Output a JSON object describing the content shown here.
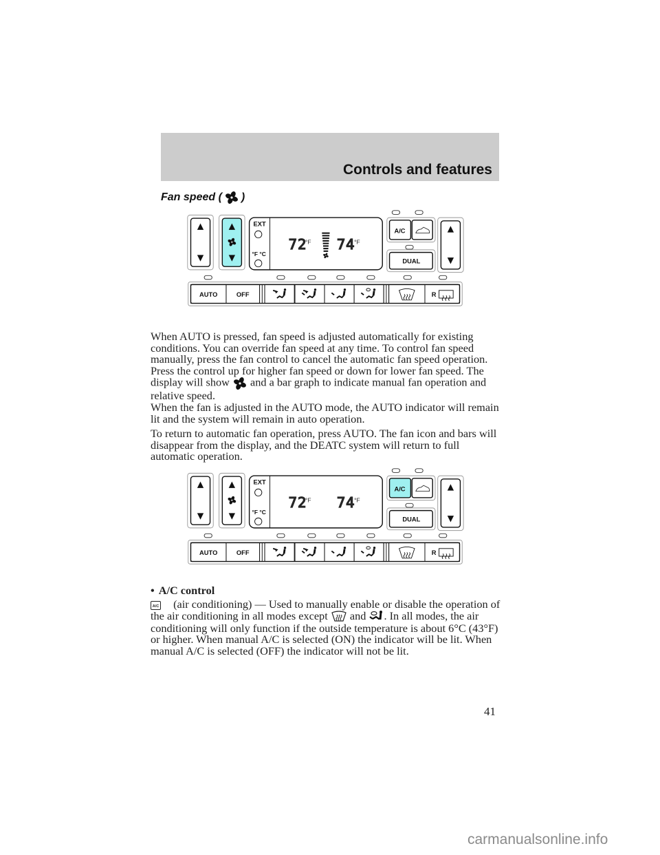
{
  "header": {
    "title": "Controls and features"
  },
  "section": {
    "title_prefix": "Fan speed (",
    "title_suffix": ")",
    "icon": "fan-icon"
  },
  "panel_labels": {
    "ext": "EXT",
    "f": "F",
    "c": "C",
    "ac": "A/C",
    "dual": "DUAL",
    "auto": "AUTO",
    "off": "OFF",
    "rear_defrost": "R",
    "temp_left": "72",
    "temp_right": "74",
    "unit": "°F"
  },
  "panels": [
    {
      "highlighted": "fan-control",
      "fan_bars_shown": true,
      "highlight_color": "#9ff0f0"
    },
    {
      "highlighted": "ac-button",
      "fan_bars_shown": false,
      "highlight_color": "#9ff0f0"
    }
  ],
  "body": {
    "p1_a": "When AUTO is pressed, fan speed is adjusted automatically for existing conditions. You can override fan speed at any time. To control fan speed manually, press the fan control to cancel the automatic fan speed operation. Press the control up for higher fan speed or down for lower fan speed. The display will show ",
    "p1_b": " and a bar graph to indicate manual fan operation and relative speed.",
    "p2": "When the fan is adjusted in the AUTO mode, the AUTO indicator will remain lit and the system will remain in auto operation.",
    "p3": "To return to automatic fan operation, press AUTO. The fan icon and bars will disappear from the display, and the DEATC system will return to full automatic operation.",
    "bullet": "•",
    "bullet_title": "A/C control",
    "ac_icon_label": "A/C",
    "p4_a": " (air conditioning) — Used to manually enable or disable the operation of the air conditioning in all modes except ",
    "p4_and": " and ",
    "p4_b": ". In all modes, the air conditioning will only function if the outside temperature is about 6°C (43°F) or higher. When manual A/C is selected (ON) the indicator will be lit. When manual A/C is selected (OFF) the indicator will not be lit."
  },
  "page_number": "41",
  "watermark": "carmanualsonline.info"
}
